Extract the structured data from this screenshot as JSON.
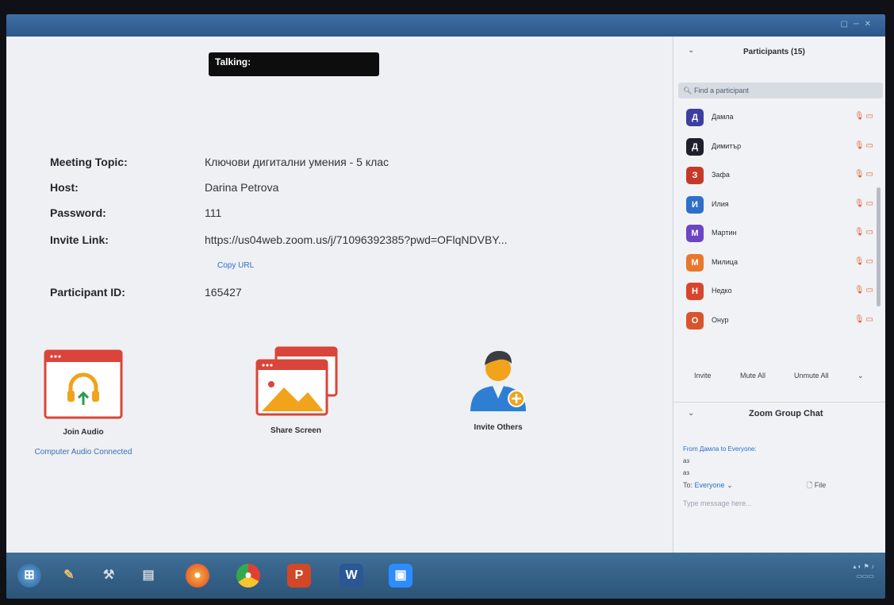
{
  "talking_label": "Talking:",
  "meeting": {
    "topic_label": "Meeting Topic:",
    "topic_value": "Ключови дигитални умения - 5 клас",
    "host_label": "Host:",
    "host_value": "Darina Petrova",
    "password_label": "Password:",
    "password_value": "111",
    "invite_label": "Invite Link:",
    "invite_value": "https://us04web.zoom.us/j/71096392385?pwd=OFlqNDVBY...",
    "copy_url": "Copy URL",
    "participant_id_label": "Participant ID:",
    "participant_id_value": "165427"
  },
  "actions": {
    "join_audio": "Join Audio",
    "audio_status": "Computer Audio Connected",
    "share_screen": "Share Screen",
    "invite_others": "Invite Others"
  },
  "participants": {
    "title": "Participants (15)",
    "search_placeholder": "Find a participant",
    "list": [
      {
        "initial": "Д",
        "name": "Дамла",
        "color": "#3b3f9e"
      },
      {
        "initial": "Д",
        "name": "Димитър",
        "color": "#1d1f2a"
      },
      {
        "initial": "З",
        "name": "Зафа",
        "color": "#c43a28"
      },
      {
        "initial": "И",
        "name": "Илия",
        "color": "#2e6fc8"
      },
      {
        "initial": "М",
        "name": "Мартин",
        "color": "#6b45c6"
      },
      {
        "initial": "М",
        "name": "Милица",
        "color": "#e8772d"
      },
      {
        "initial": "Н",
        "name": "Недко",
        "color": "#d8452f"
      },
      {
        "initial": "О",
        "name": "Онур",
        "color": "#d8552b"
      }
    ],
    "invite": "Invite",
    "mute_all": "Mute All",
    "unmute_all": "Unmute All"
  },
  "chat": {
    "title": "Zoom Group Chat",
    "from": "From Дамла to Everyone:",
    "messages": [
      "аз",
      "аз"
    ],
    "to_label": "To:",
    "to_value": "Everyone",
    "file_label": "File",
    "input_placeholder": "Type message here..."
  },
  "taskbar": {
    "items": [
      "start",
      "paint",
      "tools",
      "files",
      "firefox",
      "chrome",
      "powerpoint",
      "word",
      "zoom"
    ]
  },
  "colors": {
    "accent": "#2d8cff",
    "tile_red": "#d9453a",
    "tile_orange": "#f0a31b"
  }
}
